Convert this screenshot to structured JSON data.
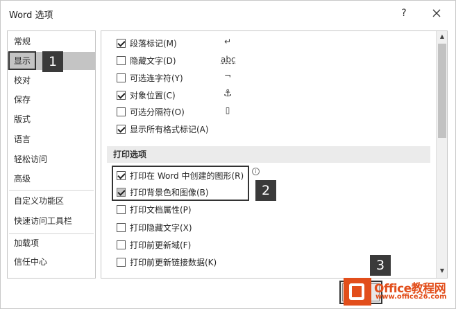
{
  "window": {
    "title": "Word 选项",
    "help": "?"
  },
  "sidebar": {
    "items": [
      {
        "label": "常规"
      },
      {
        "label": "显示"
      },
      {
        "label": "校对"
      },
      {
        "label": "保存"
      },
      {
        "label": "版式"
      },
      {
        "label": "语言"
      },
      {
        "label": "轻松访问"
      },
      {
        "label": "高级"
      },
      {
        "label": "自定义功能区"
      },
      {
        "label": "快速访问工具栏"
      },
      {
        "label": "加载项"
      },
      {
        "label": "信任中心"
      }
    ],
    "selected": "显示"
  },
  "display_options": [
    {
      "label": "段落标记(M)",
      "checked": true,
      "symbol": "↵"
    },
    {
      "label": "隐藏文字(D)",
      "checked": false,
      "symbol": "abc"
    },
    {
      "label": "可选连字符(Y)",
      "checked": false,
      "symbol": "¬"
    },
    {
      "label": "对象位置(C)",
      "checked": true,
      "symbol": "⚓"
    },
    {
      "label": "可选分隔符(O)",
      "checked": false,
      "symbol": "▯"
    },
    {
      "label": "显示所有格式标记(A)",
      "checked": true
    }
  ],
  "print_section": {
    "header": "打印选项",
    "options": [
      {
        "label": "打印在 Word 中创建的图形(R)",
        "checked": true
      },
      {
        "label": "打印背景色和图像(B)",
        "checked": true
      },
      {
        "label": "打印文档属性(P)",
        "checked": false
      },
      {
        "label": "打印隐藏文字(X)",
        "checked": false
      },
      {
        "label": "打印前更新域(F)",
        "checked": false
      },
      {
        "label": "打印前更新链接数据(K)",
        "checked": false
      }
    ]
  },
  "callouts": {
    "one": "1",
    "two": "2",
    "three": "3"
  },
  "watermark": {
    "title": "Office教程网",
    "url": "www.office26.com"
  },
  "colors": {
    "selected": "#c4c4c4",
    "callout": "#3a3a3a",
    "watermark": "#e24e1b"
  }
}
